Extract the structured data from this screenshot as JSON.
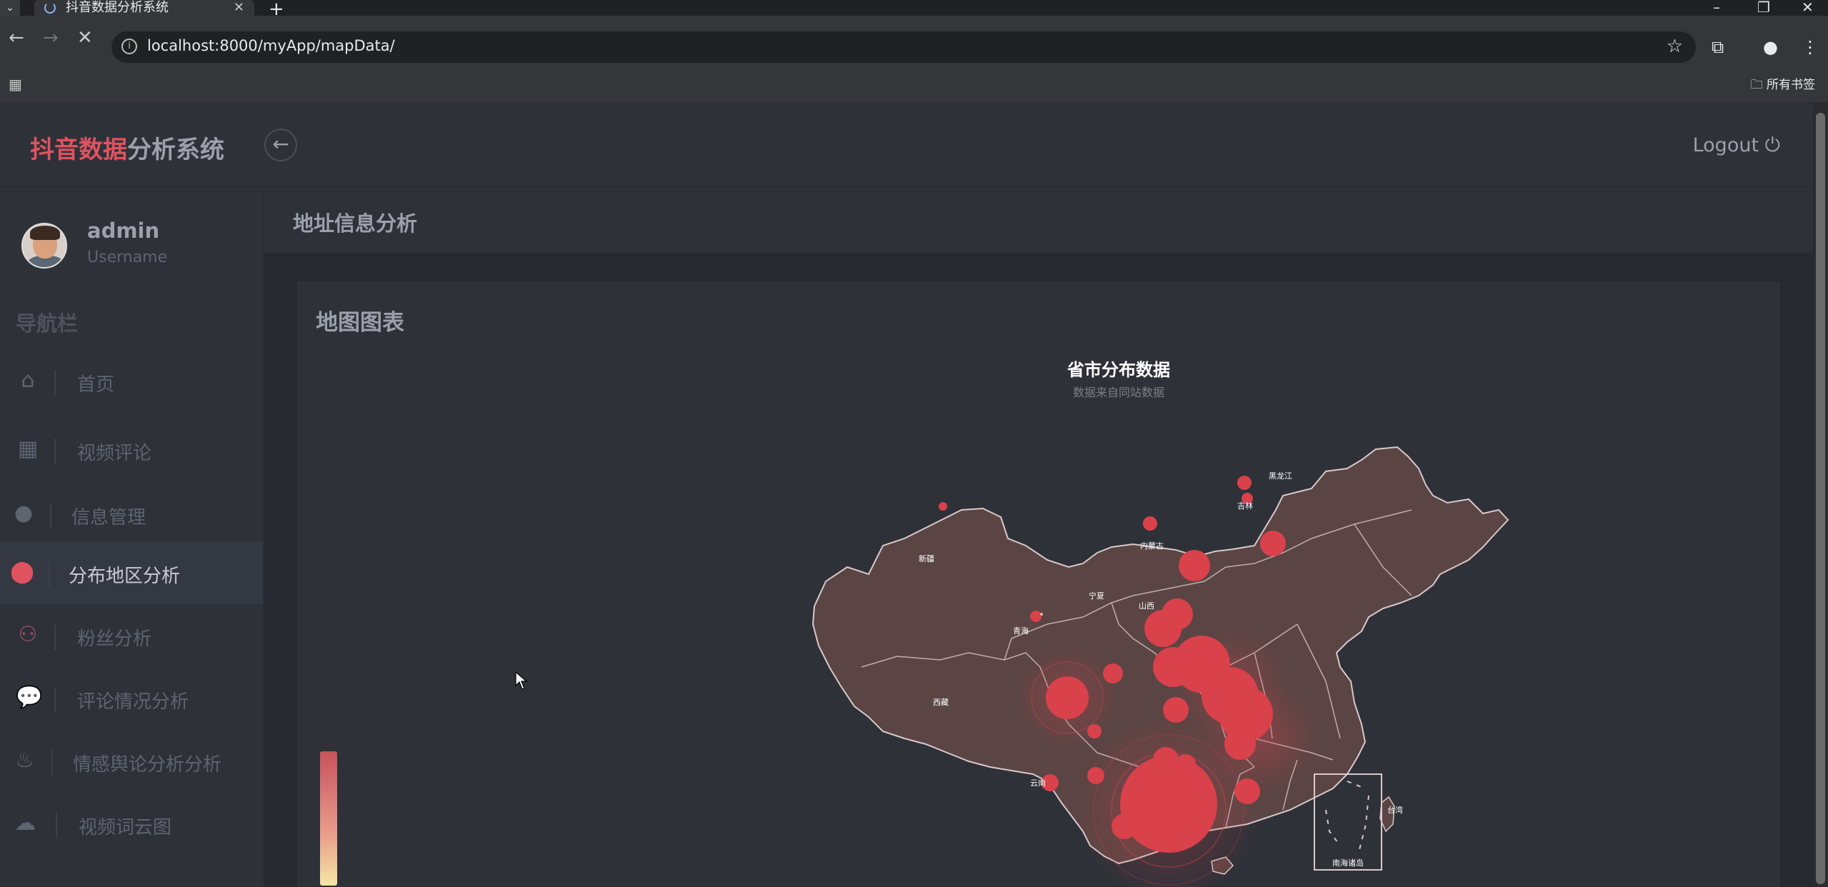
{
  "browser": {
    "tab_title": "抖音数据分析系统",
    "url": "localhost:8000/myApp/mapData/",
    "bookmarks_label": "所有书签"
  },
  "header": {
    "brand_red": "抖音数据",
    "brand_grey": "分析系统",
    "logout_label": "Logout"
  },
  "profile": {
    "name": "admin",
    "role": "Username"
  },
  "sidebar": {
    "heading": "导航栏",
    "items": [
      {
        "label": "首页",
        "icon": "home-icon"
      },
      {
        "label": "视频评论",
        "icon": "grid-icon"
      },
      {
        "label": "信息管理",
        "icon": "user-icon"
      },
      {
        "label": "分布地区分析",
        "icon": "map-pin-icon",
        "active": true
      },
      {
        "label": "粉丝分析",
        "icon": "users-icon"
      },
      {
        "label": "评论情况分析",
        "icon": "comment-icon"
      },
      {
        "label": "情感舆论分析分析",
        "icon": "fire-icon"
      },
      {
        "label": "视频词云图",
        "icon": "cloud-download-icon"
      }
    ]
  },
  "page": {
    "title": "地址信息分析",
    "card_title": "地图图表"
  },
  "chart": {
    "title": "省市分布数据",
    "subtitle": "数据来自同站数据",
    "province_labels": [
      "黑龙江",
      "吉林",
      "内蒙古",
      "新疆",
      "宁夏",
      "青海",
      "西藏",
      "山西",
      "台湾",
      "云南",
      "南海诸岛"
    ],
    "colors": {
      "map_fill": "#5b4444",
      "map_stroke": "#d9c9c9",
      "bubble": "#d9414b",
      "visualmap_high": "#c8525c",
      "visualmap_low": "#f7e6a6"
    }
  }
}
